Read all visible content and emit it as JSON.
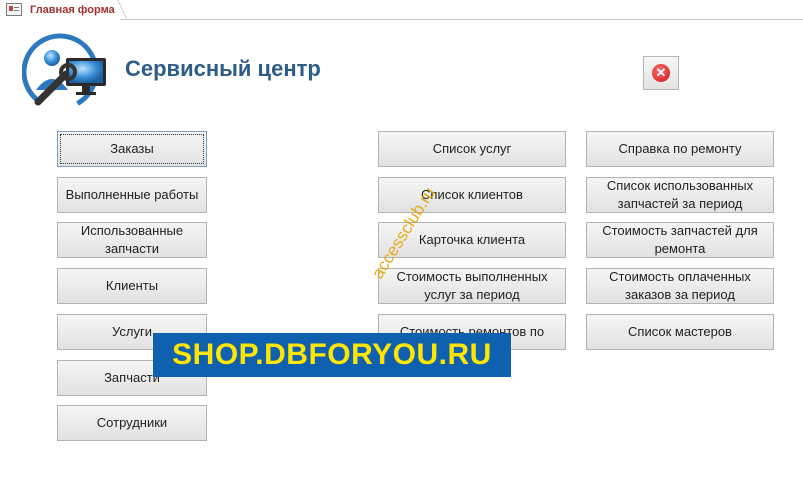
{
  "tab": {
    "label": "Главная форма",
    "icon": "form-icon"
  },
  "header": {
    "title": "Сервисный центр",
    "logo_icon": "service-logo-icon",
    "close_icon": "close-icon"
  },
  "colors": {
    "title": "#2e5c8a",
    "tab_label": "#a33131",
    "banner_bg": "#1060b0",
    "banner_text": "#ffe600",
    "watermark": "#e8a400"
  },
  "left_buttons": [
    "Заказы",
    "Выполненные работы",
    "Использованные запчасти",
    "Клиенты",
    "Услуги",
    "Запчасти",
    "Сотрудники"
  ],
  "middle_buttons": [
    "Список услуг",
    "Список клиентов",
    "Карточка клиента",
    "Стоимость выполненных услуг за период",
    "Стоимость ремонтов по"
  ],
  "right_buttons": [
    "Справка по ремонту",
    "Список использованных запчастей за период",
    "Стоимость запчастей для ремонта",
    "Стоимость оплаченных заказов за период",
    "Список мастеров"
  ],
  "overlays": {
    "diagonal_watermark": "accessclub.ru",
    "banner": "SHOP.DBFORYOU.RU"
  }
}
